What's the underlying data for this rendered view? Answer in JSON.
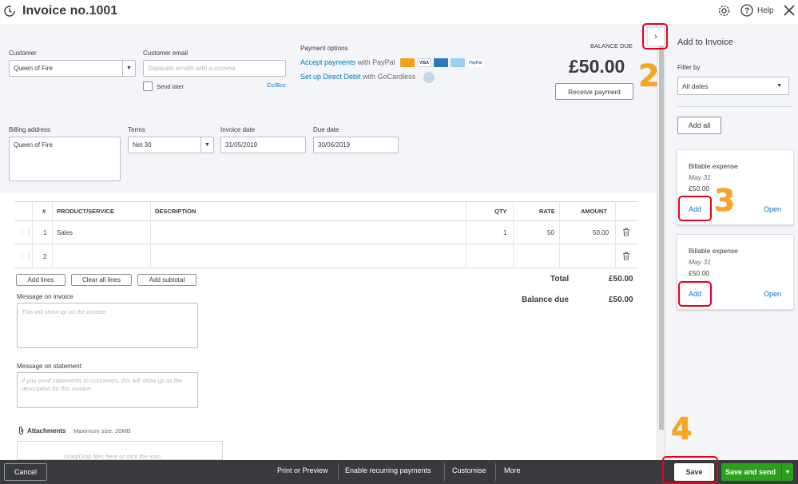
{
  "header": {
    "title": "Invoice no.1001",
    "help_label": "Help"
  },
  "customer": {
    "label": "Customer",
    "value": "Queen of Fire"
  },
  "customer_email": {
    "label": "Customer email",
    "placeholder": "Separate emails with a comma",
    "cc_bcc": "Cc/Bcc",
    "send_later": "Send later"
  },
  "payment_options": {
    "label": "Payment options",
    "paypal_link": "Accept payments",
    "paypal_text": "with PayPal",
    "direct_debit_link": "Set up Direct Debit",
    "direct_debit_text": "with GoCardless",
    "card_brands": [
      "MC",
      "VISA",
      "AMEX",
      "DISC",
      "PayPal"
    ]
  },
  "balance": {
    "label": "BALANCE DUE",
    "amount": "£50.00",
    "receive_payment": "Receive payment"
  },
  "billing": {
    "label": "Billing address",
    "value": "Queen of Fire"
  },
  "terms": {
    "label": "Terms",
    "value": "Net 30"
  },
  "invoice_date": {
    "label": "Invoice date",
    "value": "31/05/2019"
  },
  "due_date": {
    "label": "Due date",
    "value": "30/06/2019"
  },
  "table": {
    "headers": {
      "num": "#",
      "product": "PRODUCT/SERVICE",
      "description": "DESCRIPTION",
      "qty": "QTY",
      "rate": "RATE",
      "amount": "AMOUNT"
    },
    "rows": [
      {
        "num": "1",
        "product": "Sales",
        "description": "",
        "qty": "1",
        "rate": "50",
        "amount": "50.00"
      },
      {
        "num": "2",
        "product": "",
        "description": "",
        "qty": "",
        "rate": "",
        "amount": ""
      }
    ]
  },
  "line_buttons": {
    "add_lines": "Add lines",
    "clear_all": "Clear all lines",
    "add_subtotal": "Add subtotal"
  },
  "totals": {
    "total_label": "Total",
    "total_value": "£50.00",
    "balance_label": "Balance due",
    "balance_value": "£50.00"
  },
  "message_invoice": {
    "label": "Message on invoice",
    "placeholder": "This will show up on the invoice."
  },
  "message_statement": {
    "label": "Message on statement",
    "placeholder": "If you send statements to customers, this will show up as the description for this invoice."
  },
  "attachments": {
    "label": "Attachments",
    "max_size": "Maximum size: 20MB",
    "drop_text": "Drag/Drop files here or click the icon"
  },
  "sidebar": {
    "title": "Add to Invoice",
    "filter_label": "Filter by",
    "filter_value": "All dates",
    "add_all": "Add all",
    "cards": [
      {
        "type": "Billable expense",
        "date": "May 31",
        "amount": "£50.00",
        "add": "Add",
        "open": "Open"
      },
      {
        "type": "Billable expense",
        "date": "May 31",
        "amount": "£50.00",
        "add": "Add",
        "open": "Open"
      }
    ]
  },
  "annotations": {
    "step2": "2",
    "step3": "3",
    "step4": "4"
  },
  "footer": {
    "cancel": "Cancel",
    "print_preview": "Print or Preview",
    "recurring": "Enable recurring payments",
    "customise": "Customise",
    "more": "More",
    "save": "Save",
    "save_send": "Save and send"
  },
  "colors": {
    "accent_green": "#2ca01c",
    "link_blue": "#0077c5",
    "footer_bg": "#393a3d",
    "annotation_red": "#e8001a",
    "annotation_orange": "#f5a623"
  }
}
